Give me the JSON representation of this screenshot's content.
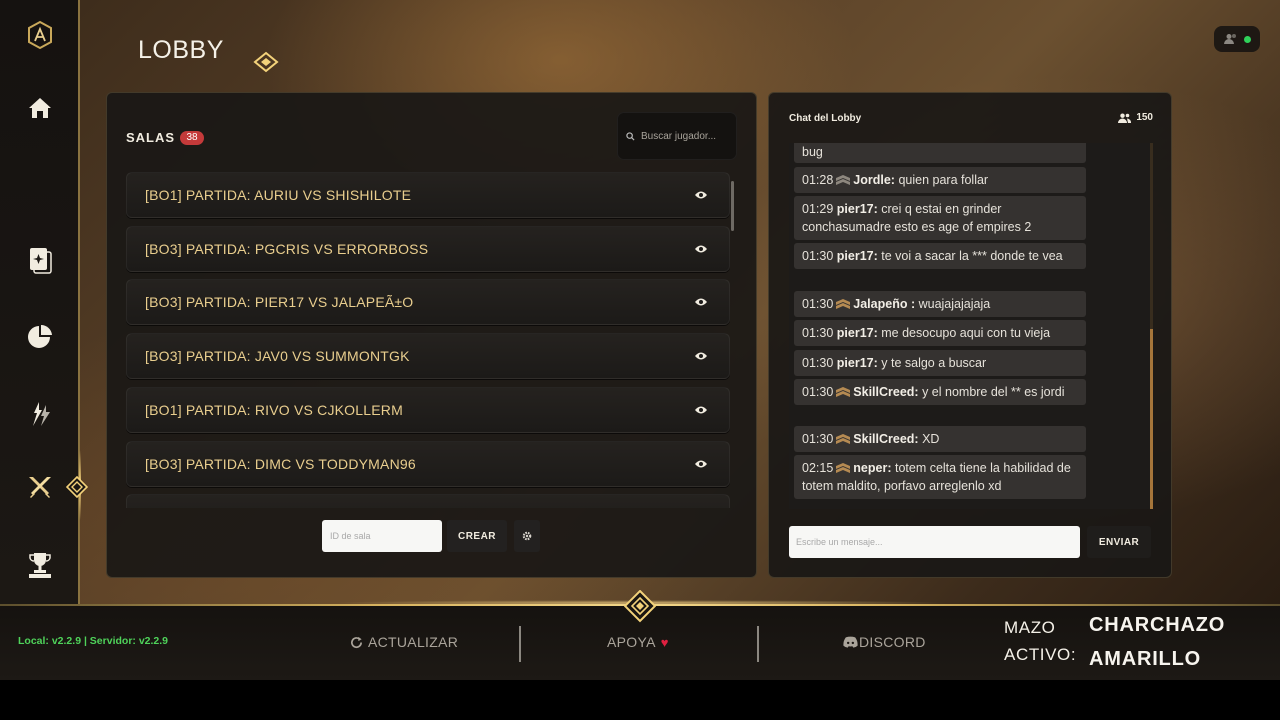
{
  "page": {
    "title": "LOBBY"
  },
  "sidebar": {
    "items": [
      {
        "name": "logo",
        "icon": "emblem-icon"
      },
      {
        "name": "home",
        "icon": "home-icon"
      },
      {
        "name": "decks",
        "icon": "card-icon"
      },
      {
        "name": "stats",
        "icon": "pie-chart-icon"
      },
      {
        "name": "clash",
        "icon": "clash-icon"
      },
      {
        "name": "lobby",
        "icon": "crossed-swords-icon",
        "active": true
      },
      {
        "name": "ranking",
        "icon": "trophy-icon"
      }
    ]
  },
  "rooms": {
    "label": "SALAS",
    "count": "38",
    "search_placeholder": "Buscar jugador...",
    "list": [
      {
        "name": "[BO1] PARTIDA: AURIU VS SHISHILOTE"
      },
      {
        "name": "[BO3] PARTIDA: PGCRIS VS ERRORBOSS"
      },
      {
        "name": "[BO3] PARTIDA: PIER17 VS JALAPEÃ±O"
      },
      {
        "name": "[BO3] PARTIDA: JAV0 VS SUMMONTGK"
      },
      {
        "name": "[BO1] PARTIDA: RIVO VS CJKOLLERM"
      },
      {
        "name": "[BO3] PARTIDA: DIMC VS TODDYMAN96"
      },
      {
        "name": ""
      }
    ],
    "room_id_placeholder": "ID de sala",
    "create_label": "CREAR"
  },
  "chat": {
    "title": "Chat del Lobby",
    "online_count": "150",
    "messages": [
      {
        "time": "",
        "user": "",
        "badge": false,
        "text": "bug"
      },
      {
        "time": "01:28",
        "user": "Jordle:",
        "badge": true,
        "text": "quien para follar"
      },
      {
        "time": "01:29",
        "user": "pier17:",
        "badge": false,
        "text": "crei q estai en grinder conchasumadre esto es age of empires 2"
      },
      {
        "time": "01:30",
        "user": "pier17:",
        "badge": false,
        "text": "te voi a sacar la *** donde te vea"
      },
      {
        "time": "01:30",
        "user": "Jalapeño :",
        "badge": true,
        "text": "wuajajajajaja"
      },
      {
        "time": "01:30",
        "user": "pier17:",
        "badge": false,
        "text": "me desocupo aqui con tu vieja"
      },
      {
        "time": "01:30",
        "user": "pier17:",
        "badge": false,
        "text": "y te salgo a buscar"
      },
      {
        "time": "01:30",
        "user": "SkillCreed:",
        "badge": true,
        "text": "y el nombre del ** es jordi"
      },
      {
        "time": "01:30",
        "user": "SkillCreed:",
        "badge": true,
        "text": "XD"
      },
      {
        "time": "02:15",
        "user": "neper:",
        "badge": true,
        "text": "totem celta tiene la habilidad de totem maldito, porfavo arreglenlo xd"
      }
    ],
    "input_placeholder": "Escribe un mensaje...",
    "send_label": "ENVIAR"
  },
  "footer": {
    "version": "Local: v2.2.9 | Servidor: v2.2.9",
    "update_label": "ACTUALIZAR",
    "support_label": "APOYA",
    "discord_label": "DISCORD",
    "deck_label_1": "MAZO",
    "deck_label_2": "ACTIVO:",
    "deck_name_1": "CHARCHAZO",
    "deck_name_2": "AMARILLO"
  },
  "colors": {
    "gold": "#e9ce8e",
    "badge_red": "#c43a3a",
    "online_green": "#2fd25a",
    "version_green": "#4fd35a",
    "heart_red": "#e02040"
  }
}
